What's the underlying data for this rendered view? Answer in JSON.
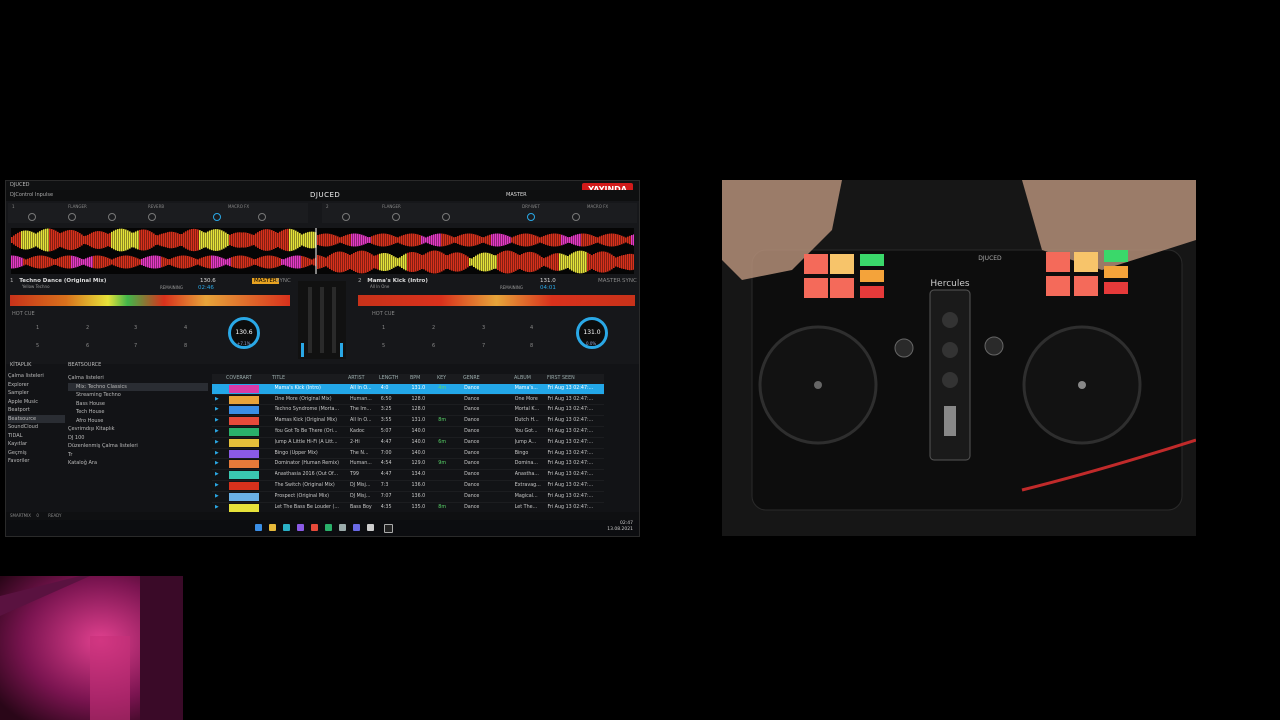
{
  "app": {
    "window_title": "DJUCED",
    "logo": "DJUCED",
    "live_badge": "YAYINDA",
    "controller": "DJControl Inpulse",
    "master_label": "MASTER",
    "deck_tabs": [
      "FX1",
      "FX2",
      "FX3"
    ],
    "status_bar": [
      "SMARTMIX",
      "0",
      "READY"
    ]
  },
  "decks": [
    {
      "num": "1",
      "title": "Techno Dance (Original Mix)",
      "artist": "Yellow Techno",
      "bpm": "130.6",
      "time": "02:46",
      "remaining_label": "REMAINING",
      "fx_labels": [
        "FLANGER",
        "REVERB",
        "MACRO FX"
      ],
      "master": "MASTER",
      "sync": "SYNC",
      "hot_cue": "HOT CUE",
      "jog_bpm": "130.6",
      "jog_sub": "+7.1%",
      "pad_numbers": [
        "1",
        "2",
        "3",
        "4",
        "5",
        "6",
        "7",
        "8"
      ]
    },
    {
      "num": "2",
      "title": "Mama's Kick (Intro)",
      "artist": "All In One",
      "bpm": "131.0",
      "time": "04:01",
      "remaining_label": "REMAINING",
      "fx_labels": [
        "FLANGER",
        "DRY-WET",
        "MACRO FX"
      ],
      "master": "MASTER",
      "sync": "SYNC",
      "hot_cue": "HOT CUE",
      "jog_bpm": "131.0",
      "jog_sub": "0.0%",
      "pad_numbers": [
        "1",
        "2",
        "3",
        "4",
        "5",
        "6",
        "7",
        "8"
      ]
    }
  ],
  "browser": {
    "library_label": "KİTAPLIK",
    "source_label": "BEATSOURCE",
    "sidebar": [
      "Çalma listeleri",
      "Explorer",
      "Sampler",
      "Apple Music",
      "Beatport",
      "Beatsource",
      "SoundCloud",
      "TIDAL",
      "Kayıtlar",
      "Geçmiş",
      "Favoriler"
    ],
    "tree": [
      "Çalma listeleri",
      "Mix: Techno Classics",
      "Streaming Techno",
      "Bass House",
      "Tech House",
      "Afro House",
      "Çevrimdışı Kitaplık",
      "DJ 100",
      "Düzenlenmiş Çalma listeleri",
      "Tr",
      "Kataloğ Ara"
    ],
    "columns": [
      "",
      "COVERART",
      "TITLE",
      "ARTIST",
      "LENGTH",
      "BPM",
      "KEY",
      "GENRE",
      "ALBUM",
      "FIRST SEEN"
    ],
    "rows": [
      {
        "title": "Mama's Kick (Intro)",
        "artist": "All In O...",
        "length": "4:0",
        "bpm": "131.0",
        "key": "4m",
        "genre": "Dance",
        "album": "Mama's...",
        "seen": "Fri Aug 13 02:47:..."
      },
      {
        "title": "One More (Original Mix)",
        "artist": "Human...",
        "length": "6:50",
        "bpm": "128.0",
        "key": "",
        "genre": "Dance",
        "album": "One More",
        "seen": "Fri Aug 13 02:47:..."
      },
      {
        "title": "Techno Syndrome (Morta...",
        "artist": "The Im...",
        "length": "3:25",
        "bpm": "128.0",
        "key": "",
        "genre": "Dance",
        "album": "Mortal K...",
        "seen": "Fri Aug 13 02:47:..."
      },
      {
        "title": "Mamas Kick (Original Mix)",
        "artist": "All In O...",
        "length": "3:55",
        "bpm": "131.0",
        "key": "8m",
        "genre": "Dance",
        "album": "Dutch H...",
        "seen": "Fri Aug 13 02:47:..."
      },
      {
        "title": "You Got To Be There (Ori...",
        "artist": "Kadoc",
        "length": "5:07",
        "bpm": "140.0",
        "key": "",
        "genre": "Dance",
        "album": "You Got...",
        "seen": "Fri Aug 13 02:47:..."
      },
      {
        "title": "Jump A Little Hi-Fi (A Litt...",
        "artist": "2-Hi",
        "length": "4:47",
        "bpm": "140.0",
        "key": "6m",
        "genre": "Dance",
        "album": "Jump A...",
        "seen": "Fri Aug 13 02:47:..."
      },
      {
        "title": "Bingo (Upper Mix)",
        "artist": "The N...",
        "length": "7:00",
        "bpm": "140.0",
        "key": "",
        "genre": "Dance",
        "album": "Bingo",
        "seen": "Fri Aug 13 02:47:..."
      },
      {
        "title": "Dominator (Human Remix)",
        "artist": "Human...",
        "length": "4:54",
        "bpm": "129.0",
        "key": "9m",
        "genre": "Dance",
        "album": "Domina...",
        "seen": "Fri Aug 13 02:47:..."
      },
      {
        "title": "Anasthasia 2016 (Out Of...",
        "artist": "T99",
        "length": "4:47",
        "bpm": "134.0",
        "key": "",
        "genre": "Dance",
        "album": "Anastha...",
        "seen": "Fri Aug 13 02:47:..."
      },
      {
        "title": "The Switch (Original Mix)",
        "artist": "DJ Misj...",
        "length": "7:3",
        "bpm": "136.0",
        "key": "",
        "genre": "Dance",
        "album": "Extravag...",
        "seen": "Fri Aug 13 02:47:..."
      },
      {
        "title": "Prospect (Original Mix)",
        "artist": "DJ Misj...",
        "length": "7:07",
        "bpm": "136.0",
        "key": "",
        "genre": "Dance",
        "album": "Magical...",
        "seen": "Fri Aug 13 02:47:..."
      },
      {
        "title": "Let The Bass Be Louder (...",
        "artist": "Bass Boy",
        "length": "4:35",
        "bpm": "135.0",
        "key": "8m",
        "genre": "Dance",
        "album": "Let The...",
        "seen": "Fri Aug 13 02:47:..."
      },
      {
        "title": "Spastik (Original Mix)",
        "artist": "Richie...",
        "length": "9:5",
        "bpm": "136.0",
        "key": "",
        "genre": "Dance",
        "album": "Recycle...",
        "seen": "Fri Aug 13 02:47:..."
      }
    ]
  },
  "taskbar": {
    "clock": "02:47",
    "date": "13.08.2021"
  },
  "camera": {
    "brand": "Hercules",
    "device": "DJUCED"
  },
  "colors": {
    "accent": "#23a7e8",
    "live": "#d11a1a",
    "wave_red": "#d8311c",
    "wave_yellow": "#e6e23a"
  }
}
